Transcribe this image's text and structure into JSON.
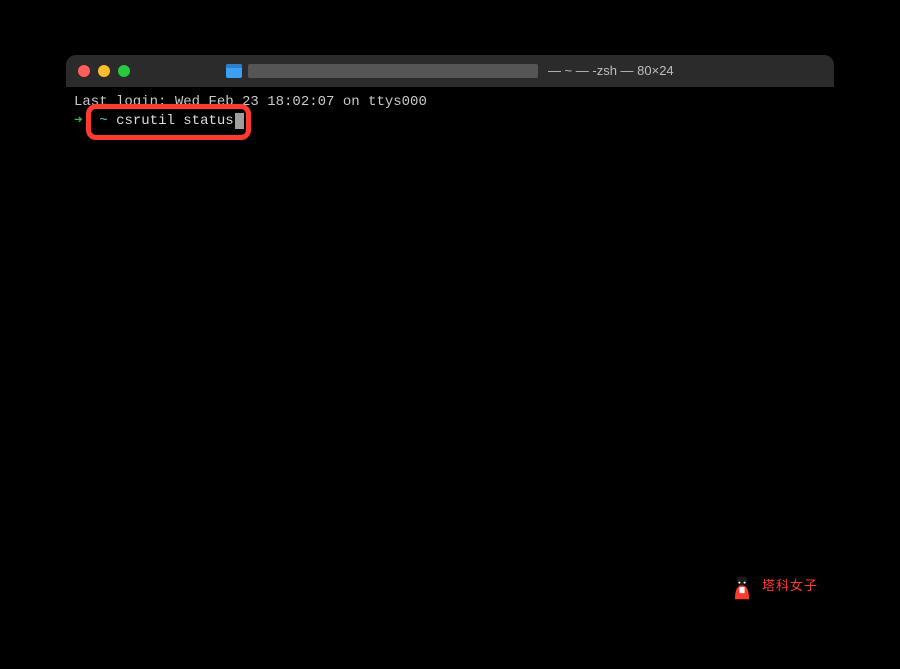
{
  "window": {
    "title_suffix": " — ~ — -zsh — 80×24"
  },
  "terminal": {
    "last_login": "Last login: Wed Feb 23 18:02:07 on ttys000",
    "prompt_arrow": "➜",
    "prompt_tilde": "~",
    "command": "csrutil status"
  },
  "watermark": {
    "text": "塔科女子"
  }
}
